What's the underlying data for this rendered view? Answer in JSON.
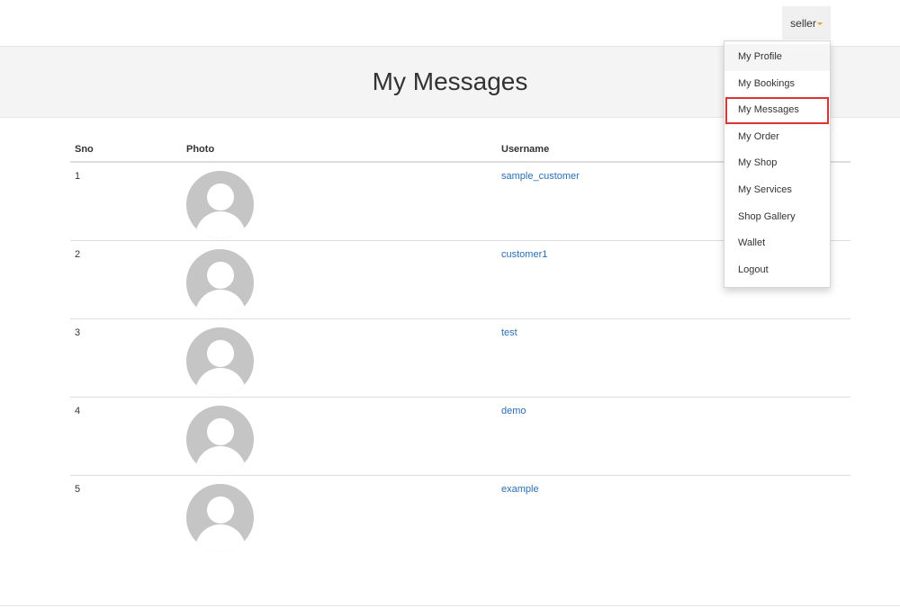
{
  "header": {
    "user_label": "seller"
  },
  "page": {
    "title": "My Messages"
  },
  "table": {
    "columns": [
      "Sno",
      "Photo",
      "Username"
    ],
    "rows": [
      {
        "sno": "1",
        "username": "sample_customer"
      },
      {
        "sno": "2",
        "username": "customer1"
      },
      {
        "sno": "3",
        "username": "test"
      },
      {
        "sno": "4",
        "username": "demo"
      },
      {
        "sno": "5",
        "username": "example"
      }
    ]
  },
  "dropdown": {
    "items": [
      "My Profile",
      "My Bookings",
      "My Messages",
      "My Order",
      "My Shop",
      "My Services",
      "Shop Gallery",
      "Wallet",
      "Logout"
    ],
    "active": "My Messages"
  },
  "colors": {
    "link": "#2a6eb5",
    "caret": "#f0a020",
    "active_outline": "#dd3333",
    "avatar": "#c5c5c5"
  },
  "icons": {
    "avatar": "default-user-avatar-icon",
    "caret": "caret-down-icon"
  }
}
